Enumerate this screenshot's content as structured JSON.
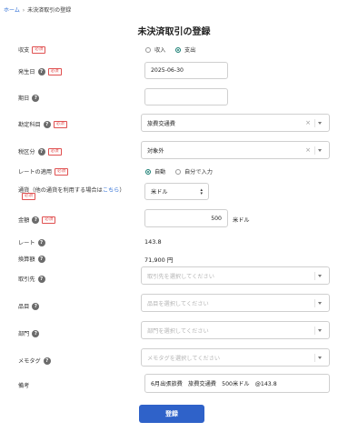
{
  "breadcrumb": {
    "home": "ホーム",
    "sep": "›",
    "current": "未決済取引の登録"
  },
  "page_title": "未決済取引の登録",
  "fields": {
    "income_expense": {
      "label": "収支",
      "required": "必須",
      "options": [
        "収入",
        "支出"
      ],
      "selected": "支出"
    },
    "issue_date": {
      "label": "発生日",
      "required": "必須",
      "value": "2025-06-30"
    },
    "due_date": {
      "label": "期日",
      "value": ""
    },
    "account": {
      "label": "勘定科目",
      "required": "必須",
      "value": "旅費交通費",
      "clear": "×"
    },
    "tax": {
      "label": "税区分",
      "required": "必須",
      "value": "対象外",
      "clear": "×"
    },
    "rate_apply": {
      "label": "レートの適用",
      "required": "必須",
      "options": [
        "自動",
        "自分で入力"
      ],
      "selected": "自動"
    },
    "currency": {
      "label": "通貨（他の通貨を利用する場合は",
      "link": "こちら",
      "label_end": "）",
      "required": "必須",
      "value": "米ドル"
    },
    "amount": {
      "label": "金額",
      "required": "必須",
      "value": "500",
      "unit": "米ドル"
    },
    "rate": {
      "label": "レート",
      "value": "143.8"
    },
    "converted": {
      "label": "換算額",
      "value": "71,900",
      "unit": "円"
    },
    "partner": {
      "label": "取引先",
      "placeholder": "取引先を選択してください"
    },
    "item": {
      "label": "品目",
      "placeholder": "品目を選択してください"
    },
    "department": {
      "label": "部門",
      "placeholder": "部門を選択してください"
    },
    "memo_tag": {
      "label": "メモタグ",
      "placeholder": "メモタグを選択してください"
    },
    "remarks": {
      "label": "備考",
      "value": "6月出張旅費　旅費交通費　500米ドル　@143.8"
    }
  },
  "submit_label": "登録",
  "colors": {
    "primary": "#2f62c9",
    "radio": "#1b7f74",
    "required": "#e05050",
    "link": "#2f6fd6"
  }
}
